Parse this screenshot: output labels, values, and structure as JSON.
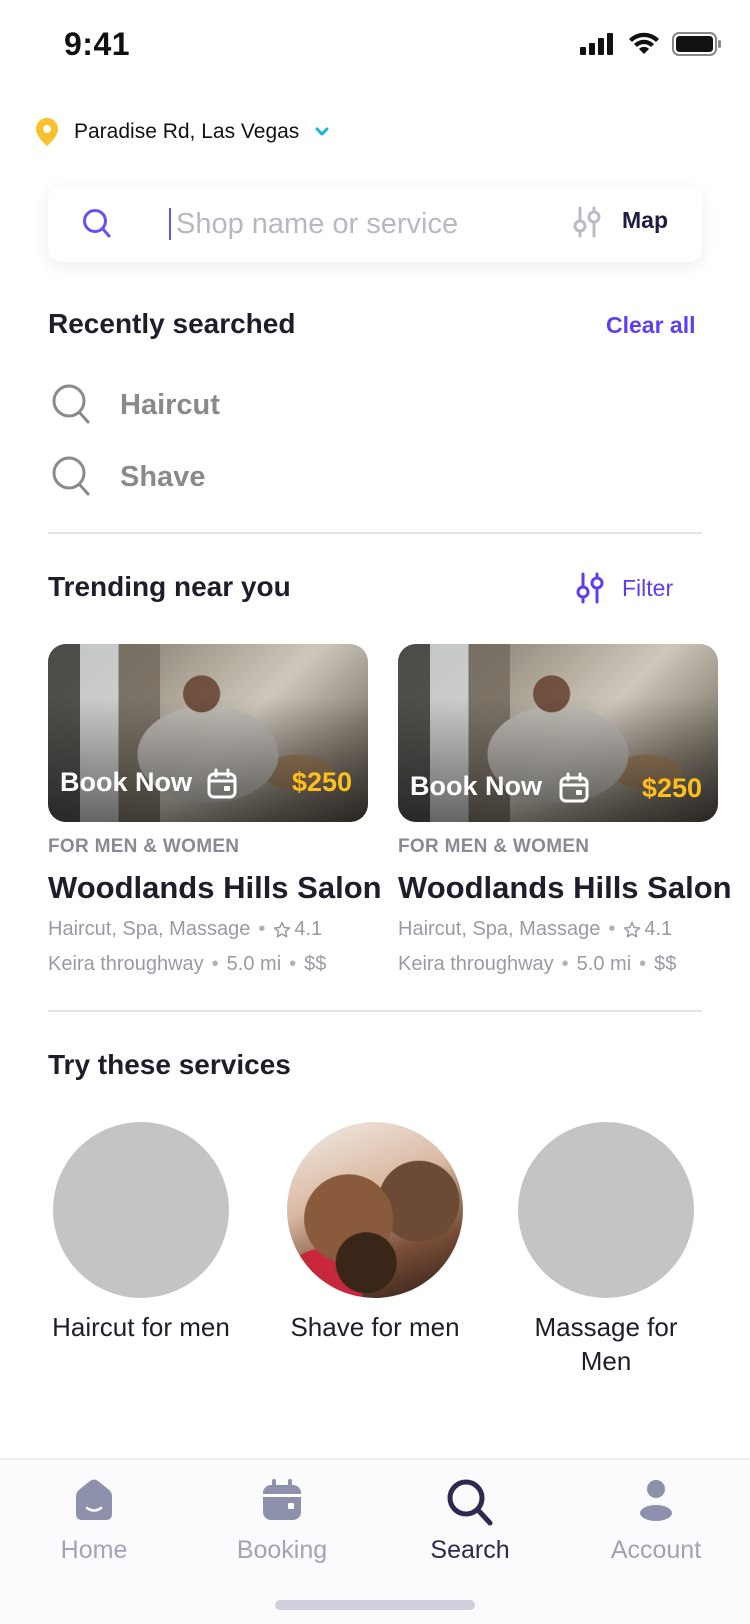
{
  "status_bar": {
    "time": "9:41"
  },
  "location": {
    "text": "Paradise Rd, Las Vegas",
    "pin_color": "#FBC02D",
    "chevron_color": "#1CB5D8"
  },
  "search": {
    "value": "",
    "placeholder": "Shop name or service",
    "map_label": "Map"
  },
  "recent": {
    "title": "Recently searched",
    "clear_label": "Clear all",
    "items": [
      {
        "label": "Haircut"
      },
      {
        "label": "Shave"
      }
    ]
  },
  "trending": {
    "title": "Trending near you",
    "filter_label": "Filter",
    "cards": [
      {
        "book_label": "Book Now",
        "price": "$250",
        "tag": "FOR MEN & WOMEN",
        "name": "Woodlands Hills Salon",
        "services": "Haircut, Spa, Massage",
        "rating": "4.1",
        "address": "Keira throughway",
        "distance": "5.0 mi",
        "price_level": "$$"
      },
      {
        "book_label": "Book Now",
        "price": "$250",
        "tag": "FOR MEN & WOMEN",
        "name": "Woodlands Hills Salon",
        "services": "Haircut, Spa, Massage",
        "rating": "4.1",
        "address": "Keira throughway",
        "distance": "5.0 mi",
        "price_level": "$$"
      }
    ]
  },
  "services": {
    "title": "Try these services",
    "items": [
      {
        "label": "Haircut for men"
      },
      {
        "label": "Shave for men"
      },
      {
        "label": "Massage for Men"
      }
    ]
  },
  "tab_bar": {
    "tabs": [
      {
        "label": "Home",
        "icon": "home-icon"
      },
      {
        "label": "Booking",
        "icon": "calendar-icon"
      },
      {
        "label": "Search",
        "icon": "search-icon"
      },
      {
        "label": "Account",
        "icon": "user-icon"
      }
    ],
    "active": "Search"
  },
  "colors": {
    "accent": "#5F3DF2",
    "price": "#FFC01E",
    "tab_active": "#2C2A50",
    "tab_inactive": "#A3A3B5"
  }
}
